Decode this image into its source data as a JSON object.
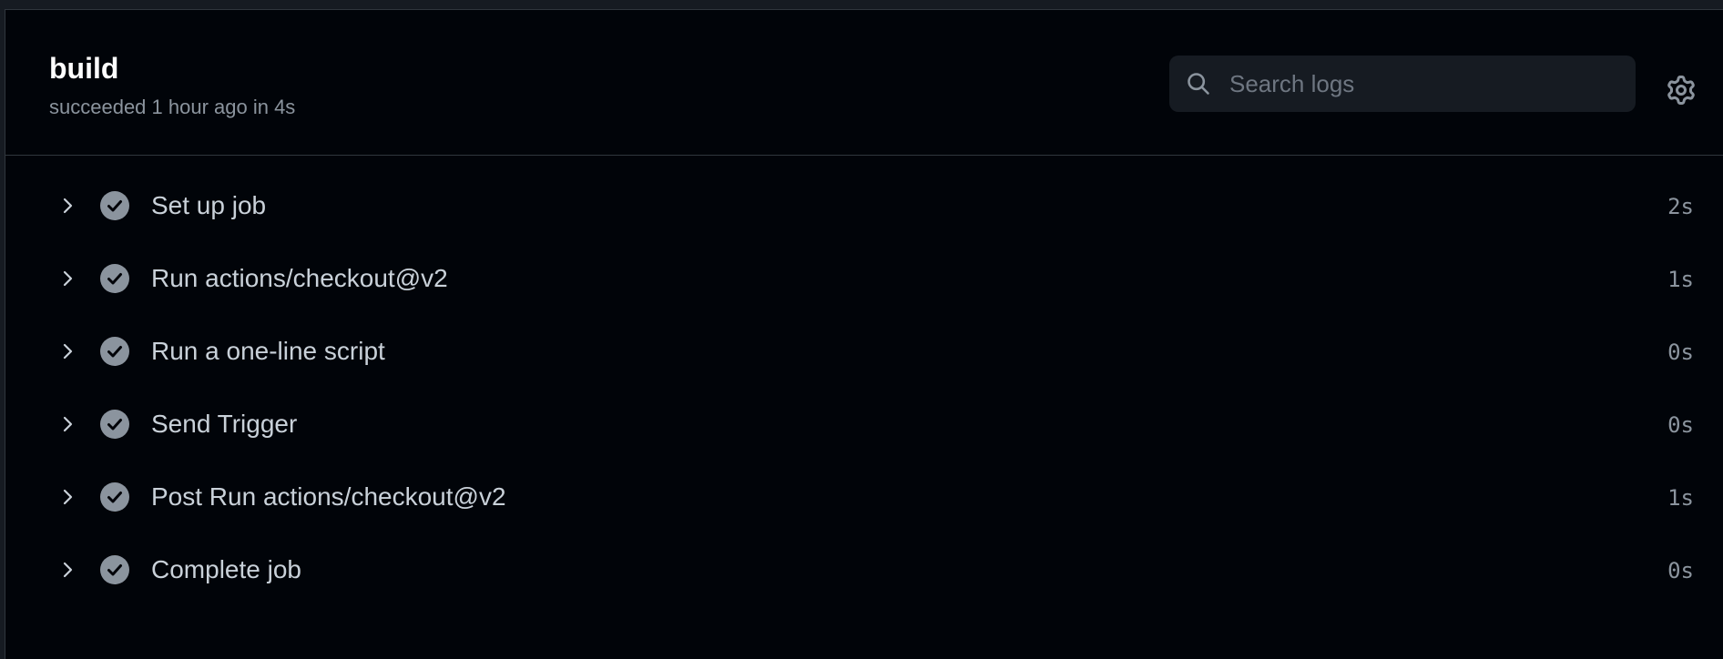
{
  "job": {
    "title": "build",
    "subtitle": "succeeded 1 hour ago in 4s"
  },
  "search": {
    "placeholder": "Search logs",
    "value": ""
  },
  "icons": {
    "search": "search-icon",
    "settings": "gear-icon",
    "expand": "chevron-right-icon",
    "status": "check-circle-icon"
  },
  "colors": {
    "background": "#010409",
    "success_icon": "#8b949e",
    "text": "#c9d1d9",
    "muted": "#8b949e"
  },
  "steps": [
    {
      "label": "Set up job",
      "duration": "2s"
    },
    {
      "label": "Run actions/checkout@v2",
      "duration": "1s"
    },
    {
      "label": "Run a one-line script",
      "duration": "0s"
    },
    {
      "label": "Send Trigger",
      "duration": "0s"
    },
    {
      "label": "Post Run actions/checkout@v2",
      "duration": "1s"
    },
    {
      "label": "Complete job",
      "duration": "0s"
    }
  ]
}
